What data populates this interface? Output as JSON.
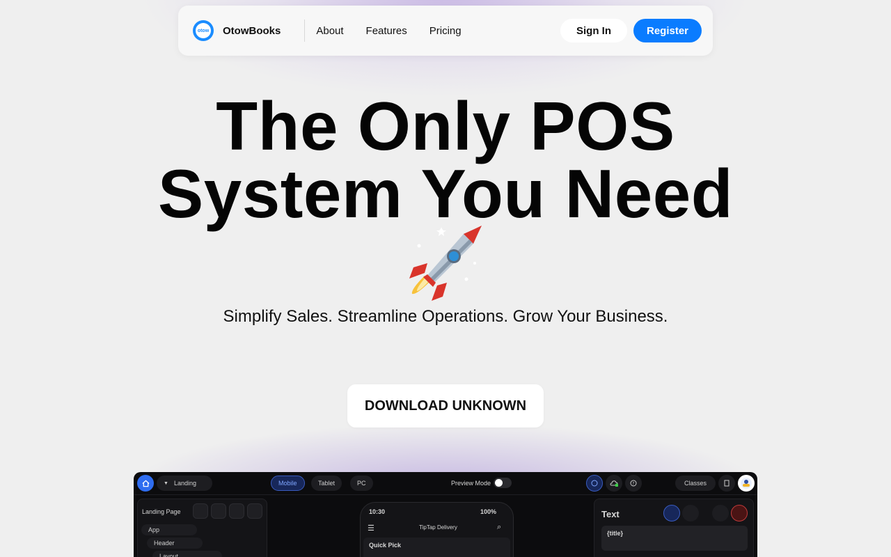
{
  "nav": {
    "brand": "OtowBooks",
    "logo_text": "otow",
    "links": [
      "About",
      "Features",
      "Pricing"
    ],
    "signin_label": "Sign In",
    "register_label": "Register"
  },
  "hero": {
    "title_line1": "The Only POS",
    "title_line2": "System You Need",
    "subtitle": "Simplify Sales. Streamline Operations. Grow Your Business.",
    "cta_label": "DOWNLOAD UNKNOWN"
  },
  "preview": {
    "page_select": "Landing",
    "device_tabs": [
      "Mobile",
      "Tablet",
      "PC"
    ],
    "active_device": "Mobile",
    "preview_mode_label": "Preview Mode",
    "classes_label": "Classes",
    "left_panel_title": "Landing Page",
    "tree": [
      "App",
      "Header",
      "Layout"
    ],
    "phone_time": "10:30",
    "phone_battery": "100%",
    "phone_app_title": "TipTap Delivery",
    "phone_section": "Quick Pick",
    "right_panel_title": "Text",
    "text_value": "{title}"
  },
  "colors": {
    "accent": "#0a7cff",
    "background": "#efefef",
    "preview_bg": "#0c0c0e"
  }
}
